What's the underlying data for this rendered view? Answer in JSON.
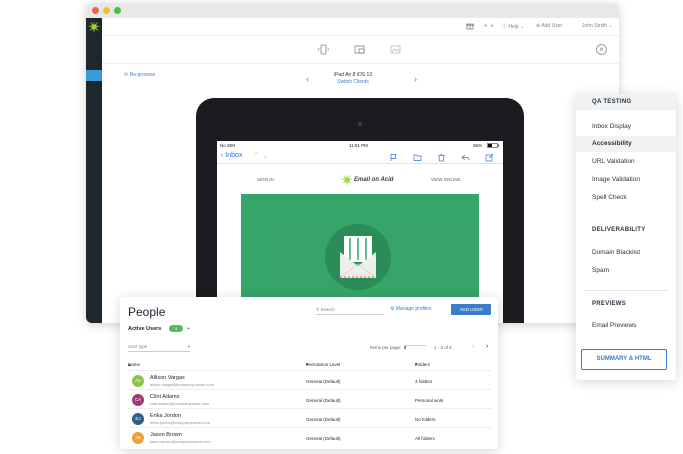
{
  "topnav": {
    "help": "Help",
    "add_user": "Add User",
    "user": "John Smith"
  },
  "toolbar": {
    "reprocess": "Re-process",
    "device_name": "iPad Air 8 iOS 13",
    "switch_clients": "Switch Clients"
  },
  "ipad": {
    "carrier": "No SIM",
    "time": "11:51 PM",
    "battery": "36%",
    "back_label": "Inbox",
    "email_left": "SIGN IN",
    "email_right": "VIEW ONLINE",
    "brand": "Email on Acid"
  },
  "people": {
    "title": "People",
    "search_placeholder": "Search",
    "manage_profiles": "Manage profiles",
    "add_user": "ADD USER",
    "active_users": "Active Users",
    "active_count": "4",
    "user_type": "User type",
    "items_per_page_label": "Items per page:",
    "items_per_page": "5",
    "range": "1 - 3 of 6",
    "columns": {
      "name": "Name",
      "permission": "Permission Level",
      "folders": "Folders"
    },
    "rows": [
      {
        "initials": "AV",
        "name": "Allison Vargas",
        "email": "alison.vargas@company-name.com",
        "permission": "General (Default)",
        "folders": "3 folders",
        "color": "#8bc34a"
      },
      {
        "initials": "CA",
        "name": "Clint Adams",
        "email": "clint.adams@companyname.com",
        "permission": "General (Default)",
        "folders": "Personal work",
        "color": "#a23b72"
      },
      {
        "initials": "EJ",
        "name": "Erika Jordon",
        "email": "erika.jordon@companyname.com",
        "permission": "General (Default)",
        "folders": "No folders",
        "color": "#2a5f86"
      },
      {
        "initials": "JB",
        "name": "Jason Brown",
        "email": "jason.brown@companyname.com",
        "permission": "General (Default)",
        "folders": "All folders",
        "color": "#f0a030"
      }
    ]
  },
  "qa_panel": {
    "qa_testing": "QA TESTING",
    "qa_items": [
      "Inbox Display",
      "Accessibility",
      "URL Validation",
      "Image Validation",
      "Spell Check"
    ],
    "active_item": "Accessibility",
    "deliverability": "DELIVERABILITY",
    "deliverability_items": [
      "Domain Blacklist",
      "Spam"
    ],
    "previews": "PREVIEWS",
    "preview_items": [
      "Email Previews"
    ],
    "summary_button": "SUMMARY & HTML"
  },
  "colors": {
    "accent": "#3a7dc9",
    "hero_green": "#35a56a",
    "sidebar": "#1f262c"
  }
}
